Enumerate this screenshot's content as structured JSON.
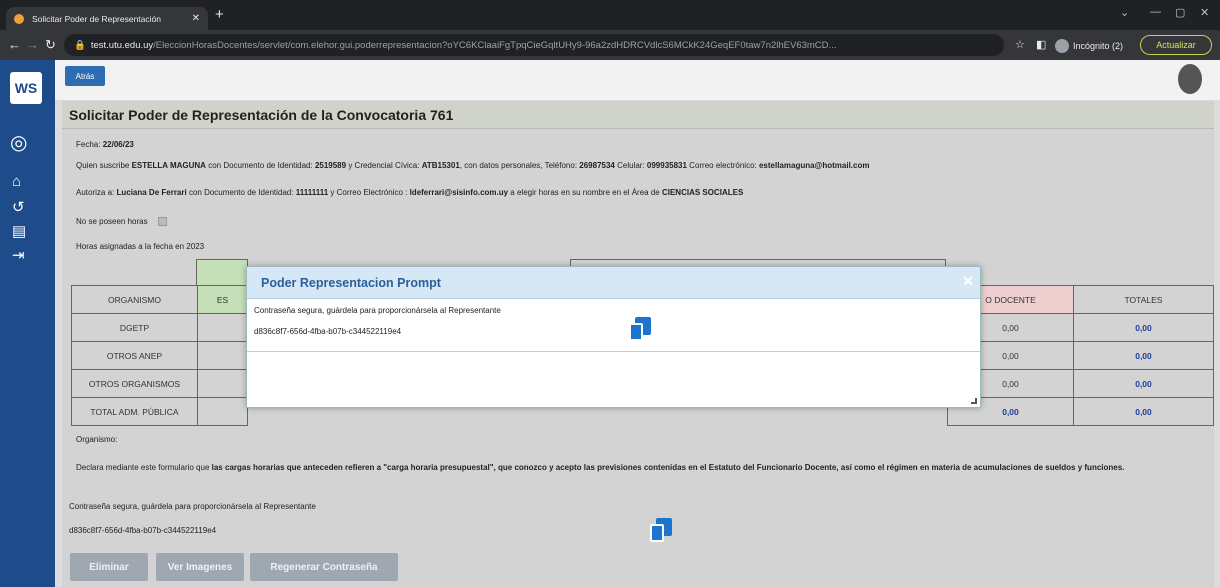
{
  "browser": {
    "tab_title": "Solicitar Poder de Representación",
    "url_domain": "test.utu.edu.uy",
    "url_path": "/EleccionHorasDocentes/servlet/com.elehor.gui.poderrepresentacion?oYC6KClaaiFgTpqCieGqltUHy9-96a2zdHDRCVdlcS6MCkK24GeqEF0taw7n2lhEV63mCD...",
    "incognito_label": "Incógnito (2)",
    "update_label": "Actualizar"
  },
  "sidebar": {
    "logo": "WS"
  },
  "toolbar": {
    "back_label": "Atrás"
  },
  "page": {
    "title": "Solicitar Poder de Representación de la Convocatoria 761",
    "fecha_label": "Fecha:",
    "fecha": "22/06/23",
    "quien_1": "Quien suscribe ",
    "nombre": "ESTELLA MAGUNA",
    "quien_2": " con Documento de Identidad: ",
    "doc": "2519589",
    "quien_3": " y Credencial Cívica: ",
    "cred": "ATB15301",
    "quien_4": ", con datos personales, Teléfono: ",
    "tel": "26987534",
    "quien_5": " Celular: ",
    "cel": "099935831",
    "quien_6": " Correo electrónico: ",
    "email": "estellamaguna@hotmail.com",
    "aut_1": "Autoriza a: ",
    "rep": "Luciana De Ferrari",
    "aut_2": " con Documento de Identidad: ",
    "rep_doc": "11111111",
    "aut_3": " y Correo Electrónico : ",
    "rep_email": "ldeferrari@sisinfo.com.uy",
    "aut_4": " a elegir horas en su nombre en el Área de ",
    "area": "CIENCIAS SOCIALES",
    "no_horas": "No se poseen horas",
    "horas_label": "Horas asignadas a la fecha en 2023",
    "organismo_label": "Organismo:",
    "declara_1": "Declara mediante este formulario que ",
    "declara_2": "las cargas horarias que anteceden refieren a \"carga horaria presupuestal\", que conozco y acepto las previsiones contenidas en el Estatuto del Funcionario Docente, así como el régimen en materia de acumulaciones de sueldos y funciones.",
    "pwd_label": "Contraseña segura, guárdela para proporcionársela al Representante",
    "pwd": "d836c8f7-656d-4fba-b07b-c344522119e4"
  },
  "table": {
    "headers": [
      "ORGANISMO",
      "ES",
      "O DOCENTE",
      "TOTALES"
    ],
    "rows": [
      [
        "DGETP",
        "0,00",
        "0,00"
      ],
      [
        "OTROS ANEP",
        "0,00",
        "0,00"
      ],
      [
        "OTROS ORGANISMOS",
        "0,00",
        "0,00"
      ],
      [
        "TOTAL ADM. PÚBLICA",
        "0,00",
        "0,00"
      ]
    ]
  },
  "buttons": {
    "eliminar": "Eliminar",
    "ver": "Ver Imagenes",
    "regenerar": "Regenerar Contraseña"
  },
  "dialog": {
    "title": "Poder Representacion Prompt",
    "msg": "Contraseña segura, guárdela para proporcionársela al Representante",
    "pwd": "d836c8f7-656d-4fba-b07b-c344522119e4"
  }
}
